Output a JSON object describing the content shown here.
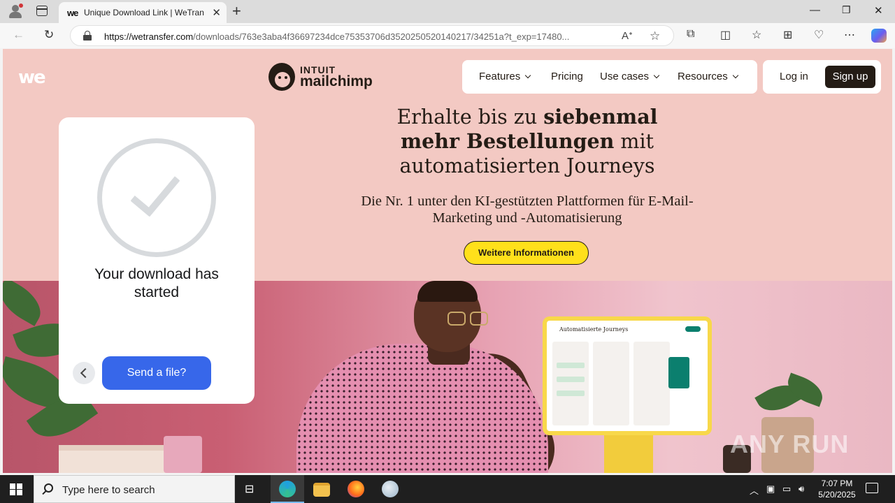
{
  "browser": {
    "tab_title": "Unique Download Link | WeTransfer",
    "tab_favicon": "we",
    "new_tab_label": "+",
    "url_domain": "https://wetransfer.com",
    "url_path": "/downloads/763e3aba4f36697234dce75353706d3520250520140217/34251a?t_exp=17480...",
    "window_controls": [
      "minimize-icon",
      "restore-icon",
      "close-icon"
    ]
  },
  "page": {
    "wetransfer_logo": "we",
    "mailchimp": {
      "brand_top": "INTUIT",
      "brand_name": "mailchimp",
      "nav": {
        "features": "Features",
        "pricing": "Pricing",
        "use_cases": "Use cases",
        "resources": "Resources"
      },
      "login": "Log in",
      "signup": "Sign up",
      "headline_1": "Erhalte bis zu ",
      "headline_bold_1": "siebenmal",
      "headline_bold_2": "mehr Bestellungen",
      "headline_2": " mit",
      "headline_3": "automatisierten Journeys",
      "subline": "Die Nr. 1 unter den KI-gestützten Plattformen für E-Mail-Marketing und -Automatisierung",
      "cta": "Weitere Informationen",
      "screen_title": "Automatisierte Journeys"
    },
    "wetransfer_panel": {
      "message": "Your download has started",
      "send_button": "Send a file?"
    },
    "watermark": "ANY RUN"
  },
  "taskbar": {
    "search_placeholder": "Type here to search",
    "time": "7:07 PM",
    "date": "5/20/2025"
  },
  "colors": {
    "page_bg": "#f3c9c3",
    "send_button": "#3767ea",
    "cta_yellow": "#ffe01b",
    "mailchimp_dark": "#241c15"
  }
}
